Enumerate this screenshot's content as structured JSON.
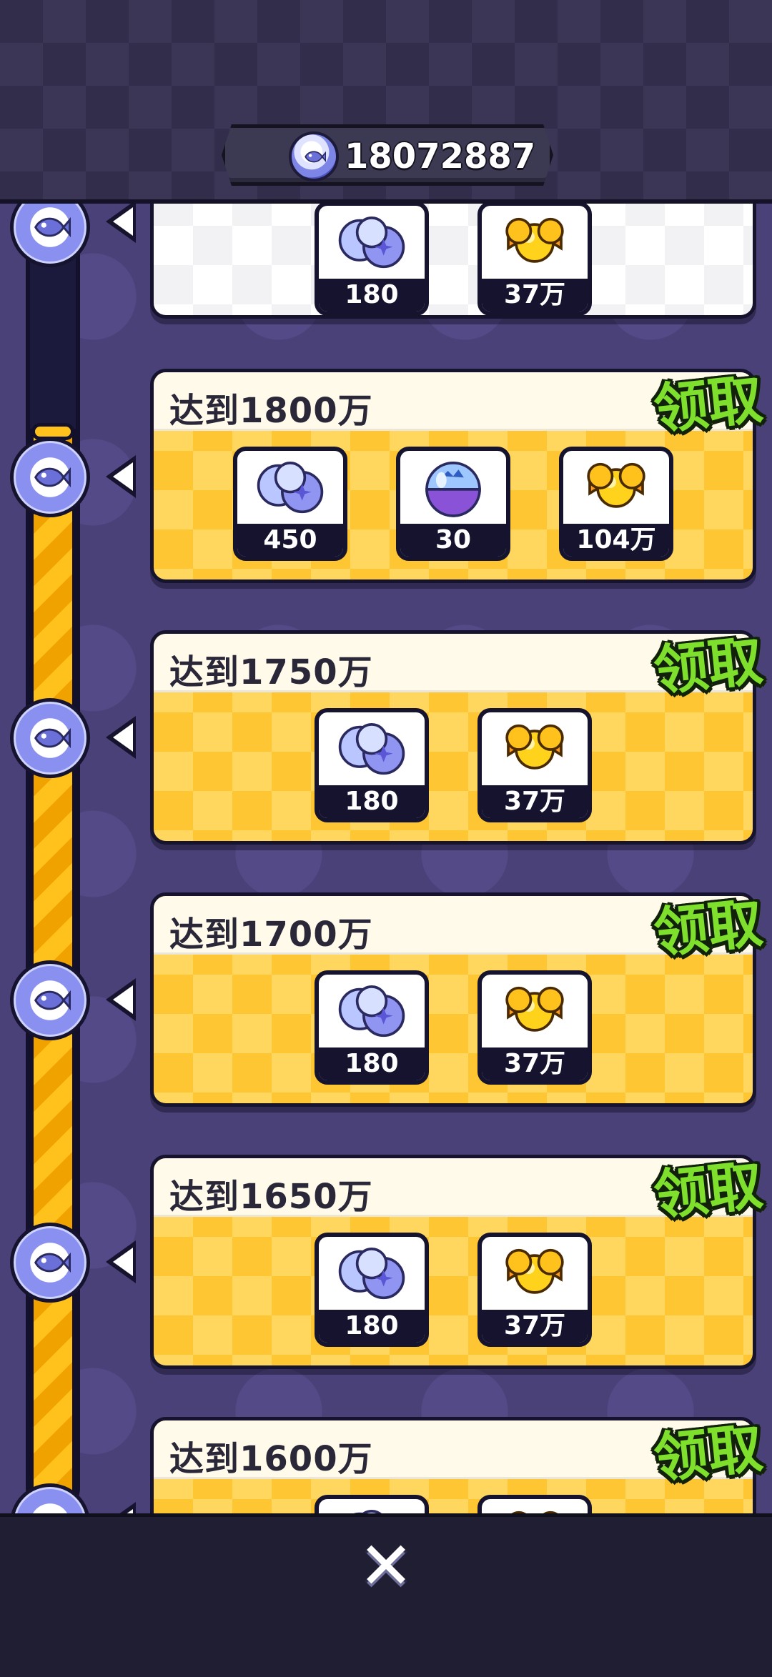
{
  "header": {
    "currency_icon": "fish-coin-icon",
    "score": "18072887"
  },
  "milestones": [
    {
      "title": "",
      "claimed": true,
      "rewards": [
        {
          "icon": "crystal-orbs-icon",
          "count": "180"
        },
        {
          "icon": "gold-candy-icon",
          "count": "37万"
        }
      ]
    },
    {
      "title": "达到1800万",
      "claim_label": "领取",
      "rewards": [
        {
          "icon": "crystal-orbs-icon",
          "count": "450"
        },
        {
          "icon": "gacha-capsule-icon",
          "count": "30"
        },
        {
          "icon": "gold-candy-icon",
          "count": "104万"
        }
      ]
    },
    {
      "title": "达到1750万",
      "claim_label": "领取",
      "rewards": [
        {
          "icon": "crystal-orbs-icon",
          "count": "180"
        },
        {
          "icon": "gold-candy-icon",
          "count": "37万"
        }
      ]
    },
    {
      "title": "达到1700万",
      "claim_label": "领取",
      "rewards": [
        {
          "icon": "crystal-orbs-icon",
          "count": "180"
        },
        {
          "icon": "gold-candy-icon",
          "count": "37万"
        }
      ]
    },
    {
      "title": "达到1650万",
      "claim_label": "领取",
      "rewards": [
        {
          "icon": "crystal-orbs-icon",
          "count": "180"
        },
        {
          "icon": "gold-candy-icon",
          "count": "37万"
        }
      ]
    },
    {
      "title": "达到1600万",
      "claim_label": "领取",
      "rewards": [
        {
          "icon": "crystal-orbs-icon",
          "count": ""
        },
        {
          "icon": "gold-candy-icon",
          "count": ""
        }
      ]
    }
  ],
  "footer": {
    "close_icon": "close-icon"
  },
  "colors": {
    "claim_green": "#7ee02c",
    "card_gold": "#ffc633",
    "background_purple": "#4a4178",
    "track_gold": "#ffc21c"
  }
}
